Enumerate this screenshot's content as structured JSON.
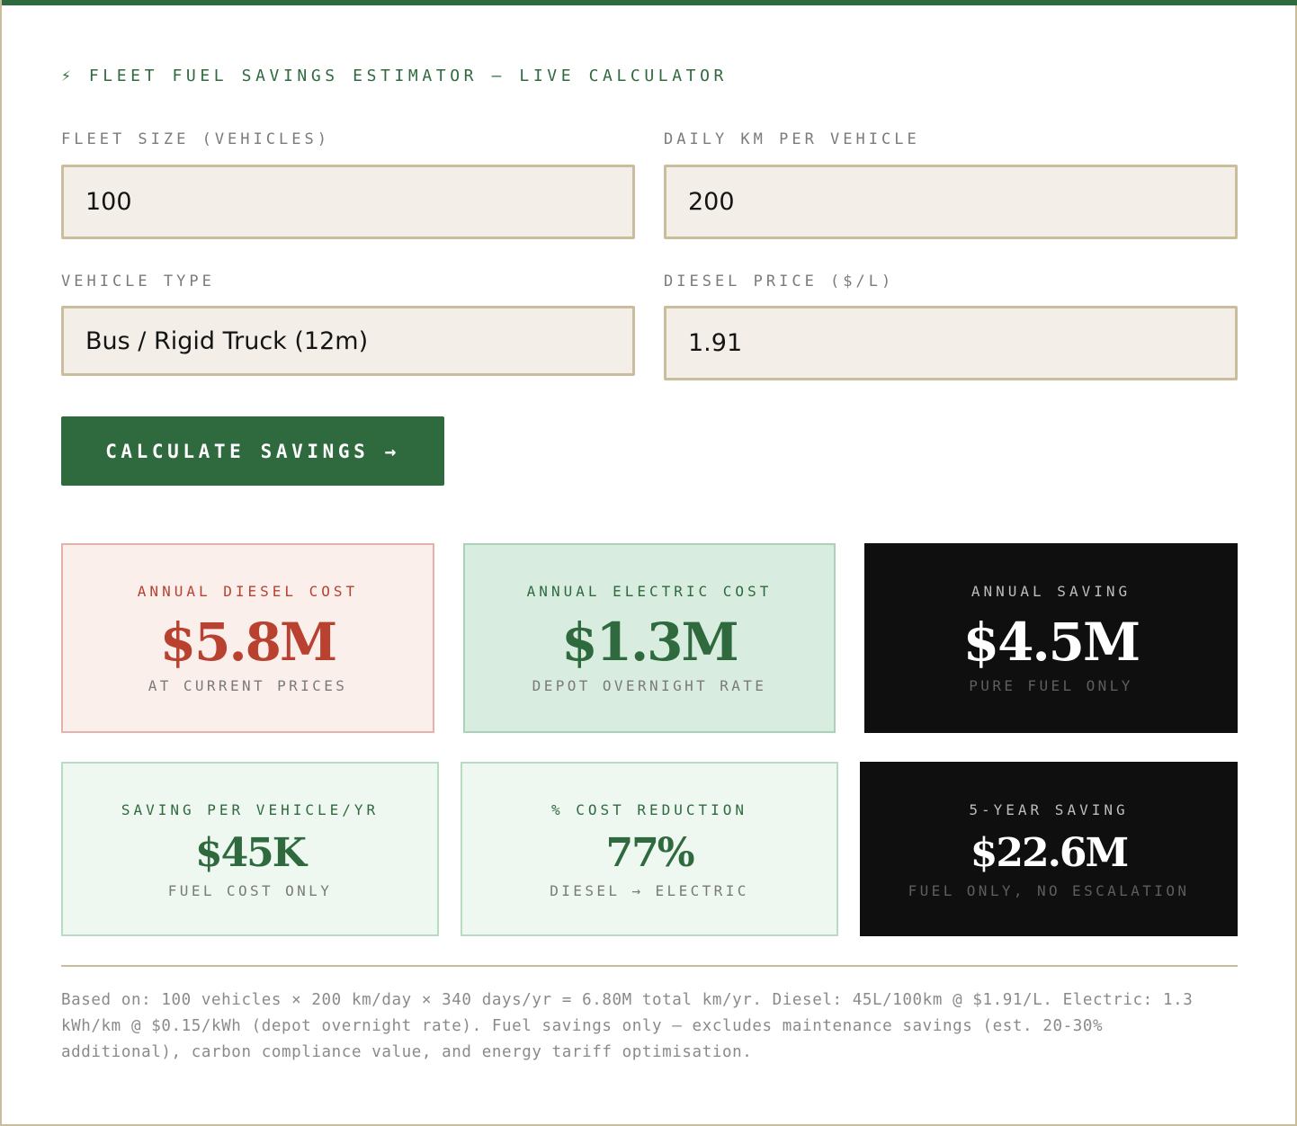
{
  "header": {
    "title": "⚡ FLEET FUEL SAVINGS ESTIMATOR — LIVE CALCULATOR"
  },
  "inputs": {
    "fleet_size": {
      "label": "FLEET SIZE (VEHICLES)",
      "value": "100"
    },
    "daily_km": {
      "label": "DAILY KM PER VEHICLE",
      "value": "200"
    },
    "vehicle_type": {
      "label": "VEHICLE TYPE",
      "value": "Bus / Rigid Truck (12m)"
    },
    "diesel_price": {
      "label": "DIESEL PRICE ($/L)",
      "value": "1.91"
    }
  },
  "actions": {
    "calculate_label": "CALCULATE SAVINGS →"
  },
  "results": {
    "annual_diesel": {
      "label": "ANNUAL DIESEL COST",
      "value": "$5.8M",
      "note": "AT CURRENT PRICES"
    },
    "annual_electric": {
      "label": "ANNUAL ELECTRIC COST",
      "value": "$1.3M",
      "note": "DEPOT OVERNIGHT RATE"
    },
    "annual_saving": {
      "label": "ANNUAL SAVING",
      "value": "$4.5M",
      "note": "PURE FUEL ONLY"
    },
    "per_vehicle": {
      "label": "SAVING PER VEHICLE/YR",
      "value": "$45K",
      "note": "FUEL COST ONLY"
    },
    "cost_reduction": {
      "label": "% COST REDUCTION",
      "value": "77%",
      "note": "DIESEL → ELECTRIC"
    },
    "five_year": {
      "label": "5-YEAR SAVING",
      "value": "$22.6M",
      "note": "FUEL ONLY, NO ESCALATION"
    }
  },
  "footnote": "Based on: 100 vehicles × 200 km/day × 340 days/yr = 6.80M total km/yr. Diesel: 45L/100km @ $1.91/L. Electric: 1.3 kWh/km @ $0.15/kWh (depot overnight rate). Fuel savings only — excludes maintenance savings (est. 20-30% additional), carbon compliance value, and energy tariff optimisation.",
  "colors": {
    "accent_green": "#2f6a3f",
    "diesel_red": "#b8412f",
    "border_tan": "#c9bd9c",
    "input_bg": "#f3efe8",
    "dark_card": "#0f0f0f"
  }
}
